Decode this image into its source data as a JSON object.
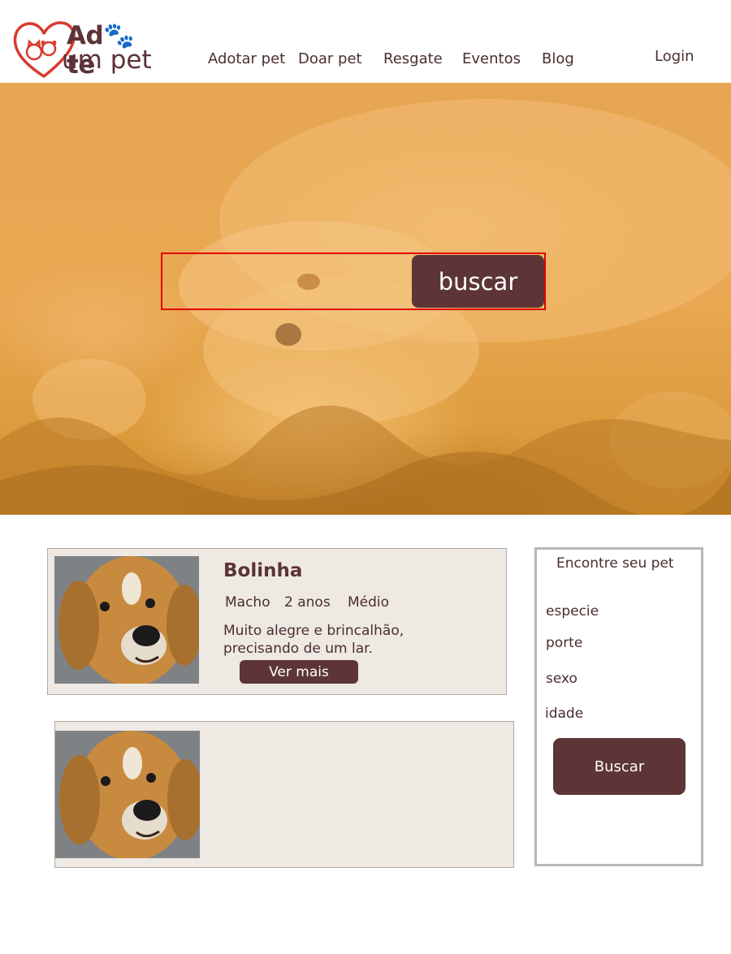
{
  "brand": {
    "line1_a": "Ad",
    "line1_b": "te",
    "line2": "um pet",
    "colors": {
      "primary": "#5c3336",
      "accent": "#d83a2e",
      "hero_overlay": "#e9a851",
      "card_bg": "#efe9e4"
    }
  },
  "nav": {
    "items": [
      {
        "label": "Adotar pet"
      },
      {
        "label": "Doar pet"
      },
      {
        "label": "Resgate"
      },
      {
        "label": "Eventos"
      },
      {
        "label": "Blog"
      }
    ],
    "login": "Login"
  },
  "hero": {
    "search_placeholder": "",
    "search_button": "buscar"
  },
  "pets": [
    {
      "name": "Bolinha",
      "sex": "Macho",
      "age": "2 anos",
      "size": "Médio",
      "description": "Muito alegre e brincalhão, precisando de um lar.",
      "more_label": "Ver mais"
    }
  ],
  "filter": {
    "title": "Encontre seu pet",
    "fields": [
      "especie",
      "porte",
      "sexo",
      "idade"
    ],
    "button": "Buscar"
  }
}
